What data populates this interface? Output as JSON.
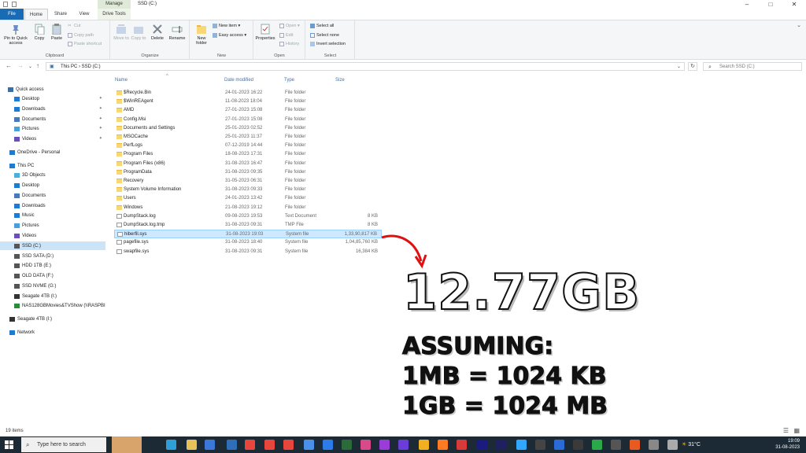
{
  "window": {
    "title": "SSD (C:)",
    "context_tab": "Manage",
    "minimize": "–",
    "maximize": "□",
    "close": "✕"
  },
  "tabs": [
    "File",
    "Home",
    "Share",
    "View",
    "Drive Tools"
  ],
  "ribbon": {
    "clipboard": {
      "label": "Clipboard",
      "pin": "Pin to Quick access",
      "copy": "Copy",
      "paste": "Paste",
      "cut": "Cut",
      "copy_path": "Copy path",
      "paste_shortcut": "Paste shortcut"
    },
    "organize": {
      "label": "Organize",
      "move_to": "Move to",
      "copy_to": "Copy to",
      "delete": "Delete",
      "rename": "Rename"
    },
    "new": {
      "label": "New",
      "new_folder": "New folder",
      "new_item": "New item ▾",
      "easy_access": "Easy access ▾"
    },
    "open": {
      "label": "Open",
      "properties": "Properties",
      "open": "Open ▾",
      "edit": "Edit",
      "history": "History"
    },
    "select": {
      "label": "Select",
      "select_all": "Select all",
      "select_none": "Select none",
      "invert": "Invert selection"
    }
  },
  "address": {
    "path": "This PC  ›  SSD (C:)",
    "search_placeholder": "Search SSD (C:)"
  },
  "sidebar": [
    {
      "label": "Quick access",
      "pinned": false
    },
    {
      "label": "Desktop",
      "pinned": true
    },
    {
      "label": "Downloads",
      "pinned": true
    },
    {
      "label": "Documents",
      "pinned": true
    },
    {
      "label": "Pictures",
      "pinned": true
    },
    {
      "label": "Videos",
      "pinned": true
    },
    {
      "label": "OneDrive - Personal"
    },
    {
      "label": "This PC"
    },
    {
      "label": "3D Objects"
    },
    {
      "label": "Desktop"
    },
    {
      "label": "Documents"
    },
    {
      "label": "Downloads"
    },
    {
      "label": "Music"
    },
    {
      "label": "Pictures"
    },
    {
      "label": "Videos"
    },
    {
      "label": "SSD (C:)"
    },
    {
      "label": "SSD SATA (D:)"
    },
    {
      "label": "HDD 1TB (E:)"
    },
    {
      "label": "OLD DATA (F:)"
    },
    {
      "label": "SSD NVME (G:)"
    },
    {
      "label": "Seagate 4TB (I:)"
    },
    {
      "label": "NAS128GBMovies&TVShow (\\\\RASPBI"
    },
    {
      "label": "Seagate 4TB (I:)"
    },
    {
      "label": "Network"
    }
  ],
  "columns": {
    "name": "Name",
    "date": "Date modified",
    "type": "Type",
    "size": "Size"
  },
  "files": [
    {
      "name": "$Recycle.Bin",
      "date": "24-01-2023 16:22",
      "type": "File folder",
      "size": ""
    },
    {
      "name": "$WinREAgent",
      "date": "11-08-2023 18:04",
      "type": "File folder",
      "size": ""
    },
    {
      "name": "AMD",
      "date": "27-01-2023 15:08",
      "type": "File folder",
      "size": ""
    },
    {
      "name": "Config.Msi",
      "date": "27-01-2023 15:08",
      "type": "File folder",
      "size": ""
    },
    {
      "name": "Documents and Settings",
      "date": "25-01-2023 02:52",
      "type": "File folder",
      "size": ""
    },
    {
      "name": "MSOCache",
      "date": "25-01-2023 11:37",
      "type": "File folder",
      "size": ""
    },
    {
      "name": "PerfLogs",
      "date": "07-12-2019 14:44",
      "type": "File folder",
      "size": ""
    },
    {
      "name": "Program Files",
      "date": "18-08-2023 17:31",
      "type": "File folder",
      "size": ""
    },
    {
      "name": "Program Files (x86)",
      "date": "31-08-2023 16:47",
      "type": "File folder",
      "size": ""
    },
    {
      "name": "ProgramData",
      "date": "31-08-2023 09:35",
      "type": "File folder",
      "size": ""
    },
    {
      "name": "Recovery",
      "date": "31-05-2023 06:31",
      "type": "File folder",
      "size": ""
    },
    {
      "name": "System Volume Information",
      "date": "31-08-2023 09:33",
      "type": "File folder",
      "size": ""
    },
    {
      "name": "Users",
      "date": "24-01-2023 13:42",
      "type": "File folder",
      "size": ""
    },
    {
      "name": "Windows",
      "date": "21-08-2023 19:12",
      "type": "File folder",
      "size": ""
    },
    {
      "name": "DumpStack.log",
      "date": "09-08-2023 19:53",
      "type": "Text Document",
      "size": "8 KB"
    },
    {
      "name": "DumpStack.log.tmp",
      "date": "31-08-2023 09:31",
      "type": "TMP File",
      "size": "8 KB"
    },
    {
      "name": "hiberfil.sys",
      "date": "31-08-2023 19:03",
      "type": "System file",
      "size": "1,33,90,817 KB",
      "selected": true
    },
    {
      "name": "pagefile.sys",
      "date": "31-08-2023 18:40",
      "type": "System file",
      "size": "1,04,85,760 KB"
    },
    {
      "name": "swapfile.sys",
      "date": "31-08-2023 09:31",
      "type": "System file",
      "size": "16,384 KB"
    }
  ],
  "status": {
    "items": "19 items"
  },
  "taskbar": {
    "search": "Type here to search",
    "weather": "31°C",
    "time": "19:09",
    "date": "31-08-2023"
  },
  "overlay": {
    "size": "12.77GB",
    "l1": "ASSUMING:",
    "l2": "1MB = 1024 KB",
    "l3": "1GB = 1024 MB"
  },
  "colors": {
    "accent": "#1a6bb5",
    "folder": "#f8d775",
    "arrow": "#e01010",
    "selection": "#cde8ff"
  }
}
